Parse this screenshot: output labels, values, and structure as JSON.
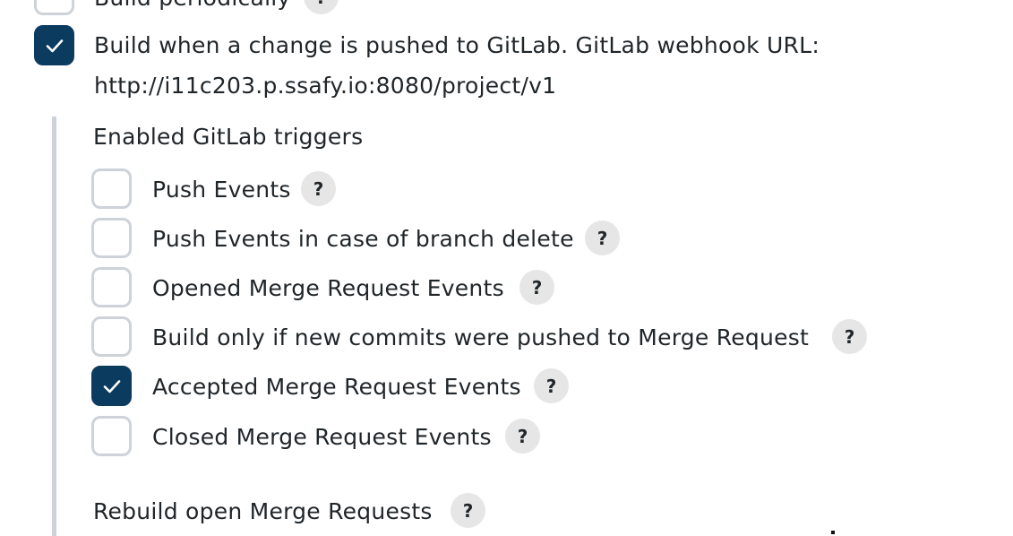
{
  "build_periodically": {
    "label": "Build periodically",
    "help": "?",
    "checked": false
  },
  "gitlab_trigger": {
    "label_line1": "Build when a change is pushed to GitLab. GitLab webhook URL:",
    "label_line2": "http://i11c203.p.ssafy.io:8080/project/v1",
    "checked": true
  },
  "section": {
    "title": "Enabled GitLab triggers",
    "items": [
      {
        "label": "Push Events",
        "help": "?",
        "checked": false
      },
      {
        "label": "Push Events in case of branch delete",
        "help": "?",
        "checked": false
      },
      {
        "label": "Opened Merge Request Events",
        "help": "?",
        "checked": false
      },
      {
        "label": "Build only if new commits were pushed to Merge Request",
        "help": "?",
        "checked": false
      },
      {
        "label": "Accepted Merge Request Events",
        "help": "?",
        "checked": true
      },
      {
        "label": "Closed Merge Request Events",
        "help": "?",
        "checked": false
      }
    ],
    "rebuild_label": "Rebuild open Merge Requests",
    "rebuild_help": "?"
  },
  "colors": {
    "accent": "#0c3b60",
    "border": "#cdd3d9",
    "help_bg": "#e6e6e6",
    "text": "#1f2529"
  },
  "icons": {
    "checked": "checkmark-icon",
    "help": "help-icon"
  }
}
